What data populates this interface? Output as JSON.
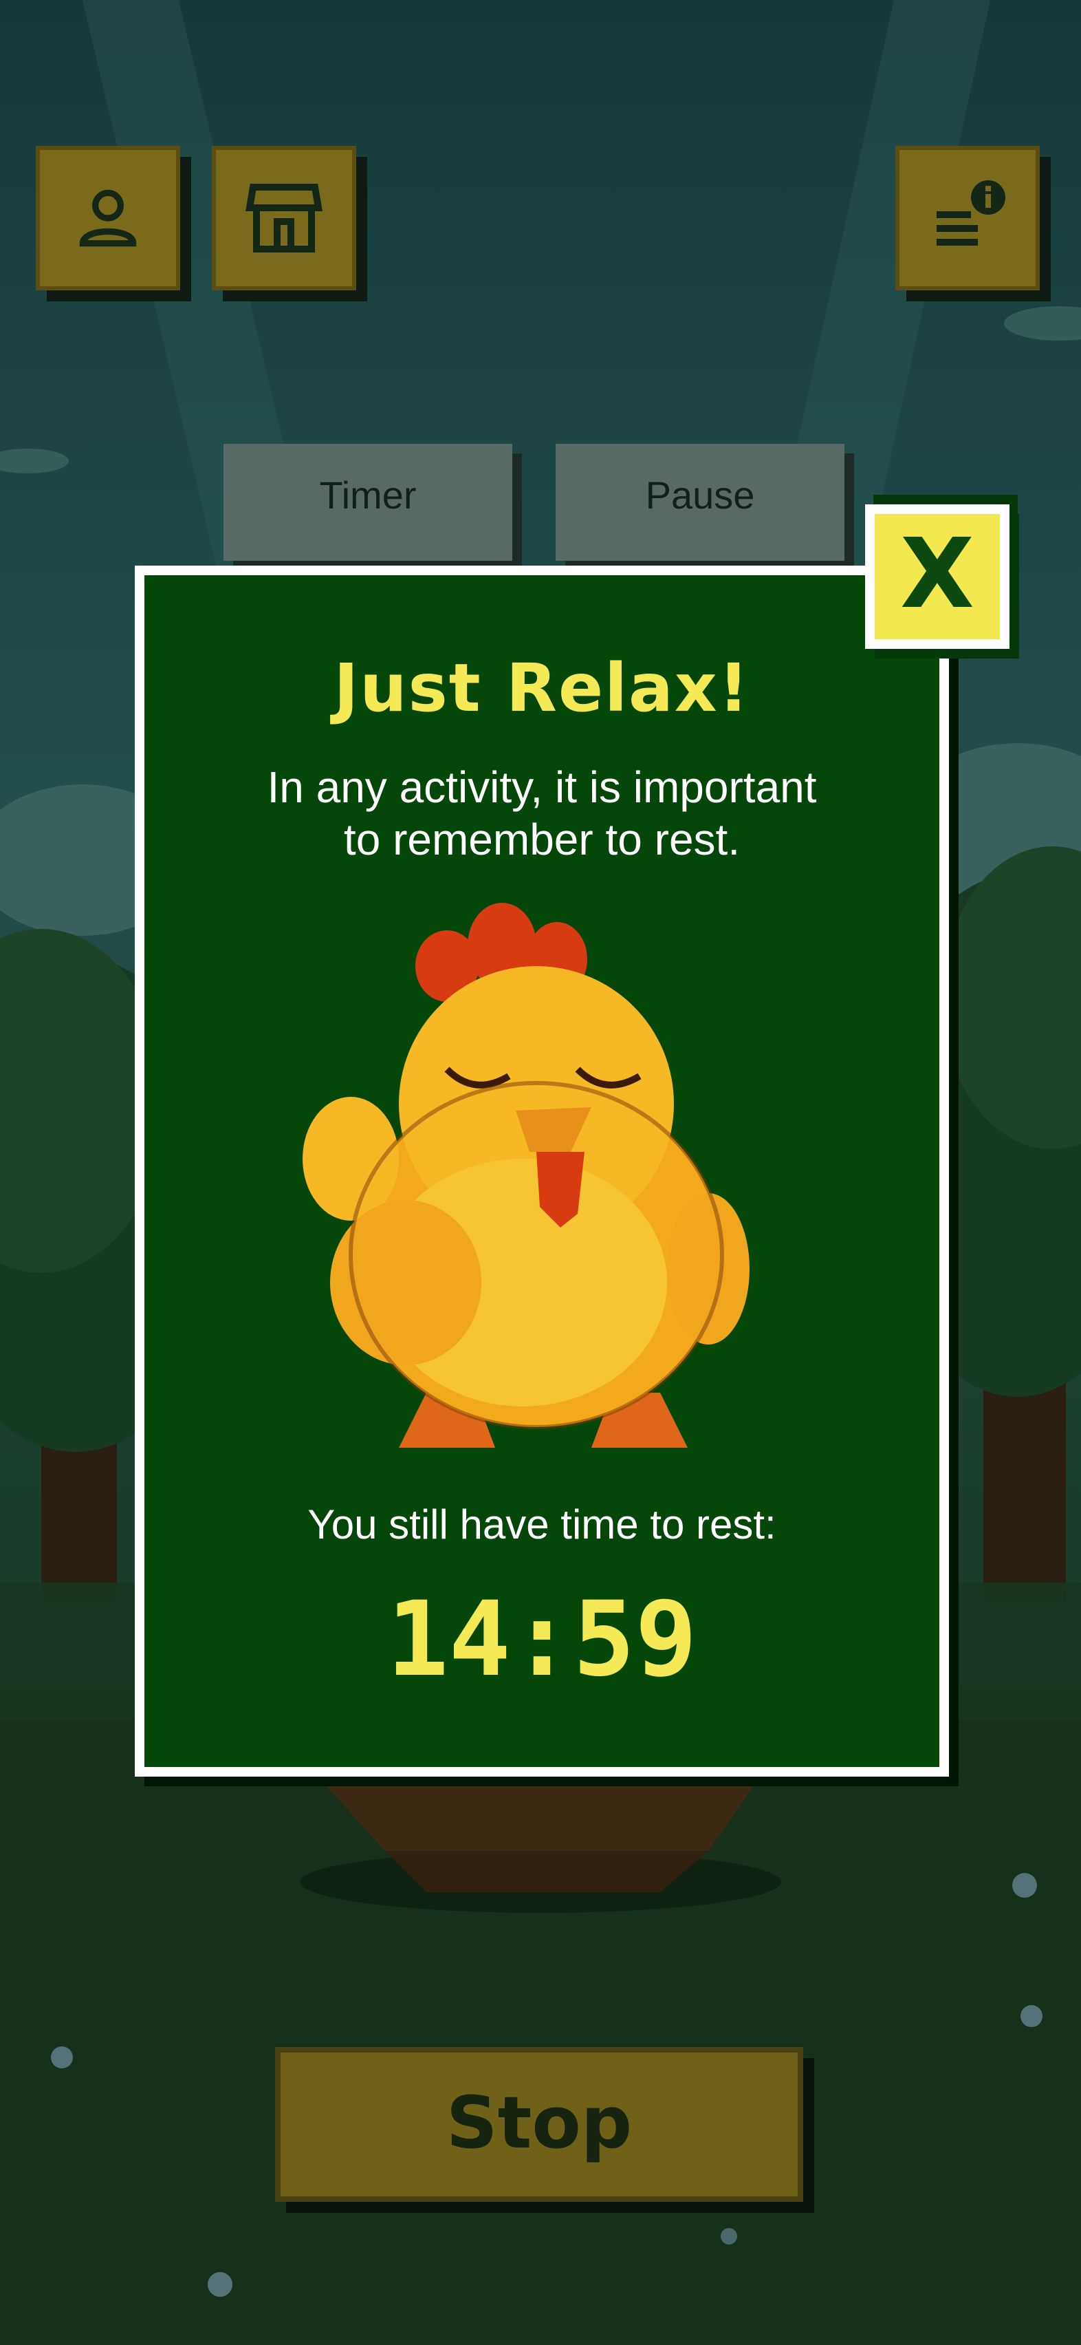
{
  "top_bar": {
    "profile_icon": "person-icon",
    "shop_icon": "storefront-icon",
    "info_icon": "list-info-icon"
  },
  "stats": {
    "timer_label": "Timer",
    "pause_label": "Pause"
  },
  "modal": {
    "title": "Just Relax!",
    "subtitle_line1": "In any activity, it is important",
    "subtitle_line2": "to remember to rest.",
    "rest_label": "You still have time to rest:",
    "rest_timer": "14:59",
    "close_label": "X"
  },
  "stop_button": {
    "label": "Stop"
  },
  "colors": {
    "modal_bg": "#044709",
    "accent_yellow": "#f5ea55",
    "button_olive": "#7a6a1c"
  }
}
